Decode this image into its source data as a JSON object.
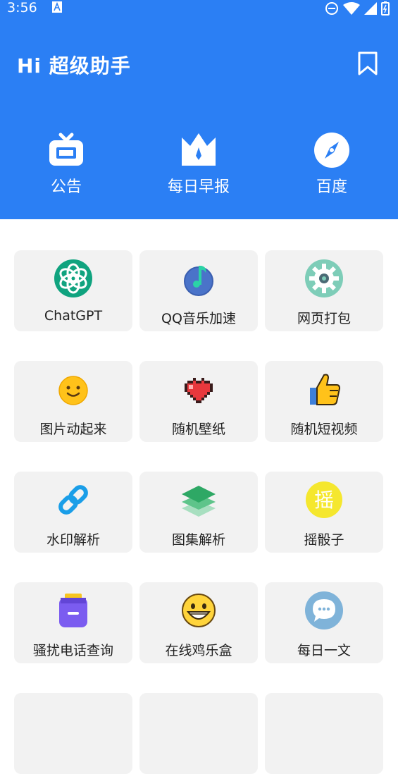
{
  "status": {
    "time": "3:56"
  },
  "header": {
    "title": "Hi 超级助手"
  },
  "shortcuts": [
    {
      "label": "公告",
      "icon": "announcement-icon"
    },
    {
      "label": "每日早报",
      "icon": "crown-icon"
    },
    {
      "label": "百度",
      "icon": "compass-icon"
    }
  ],
  "tools": [
    {
      "label": "ChatGPT",
      "icon": "chatgpt-icon"
    },
    {
      "label": "QQ音乐加速",
      "icon": "music-note-icon"
    },
    {
      "label": "网页打包",
      "icon": "gear-icon"
    },
    {
      "label": "图片动起来",
      "icon": "smiley-icon"
    },
    {
      "label": "随机壁纸",
      "icon": "heart-icon"
    },
    {
      "label": "随机短视频",
      "icon": "thumbs-up-icon"
    },
    {
      "label": "水印解析",
      "icon": "link-icon"
    },
    {
      "label": "图集解析",
      "icon": "layers-icon"
    },
    {
      "label": "摇骰子",
      "icon": "shake-icon"
    },
    {
      "label": "骚扰电话查询",
      "icon": "archive-box-icon"
    },
    {
      "label": "在线鸡乐盒",
      "icon": "grin-face-icon"
    },
    {
      "label": "每日一文",
      "icon": "chat-bubble-icon"
    }
  ],
  "shake_icon_char": "摇",
  "colors": {
    "header_bg": "#2b7ff4",
    "card_bg": "#f2f2f2"
  }
}
